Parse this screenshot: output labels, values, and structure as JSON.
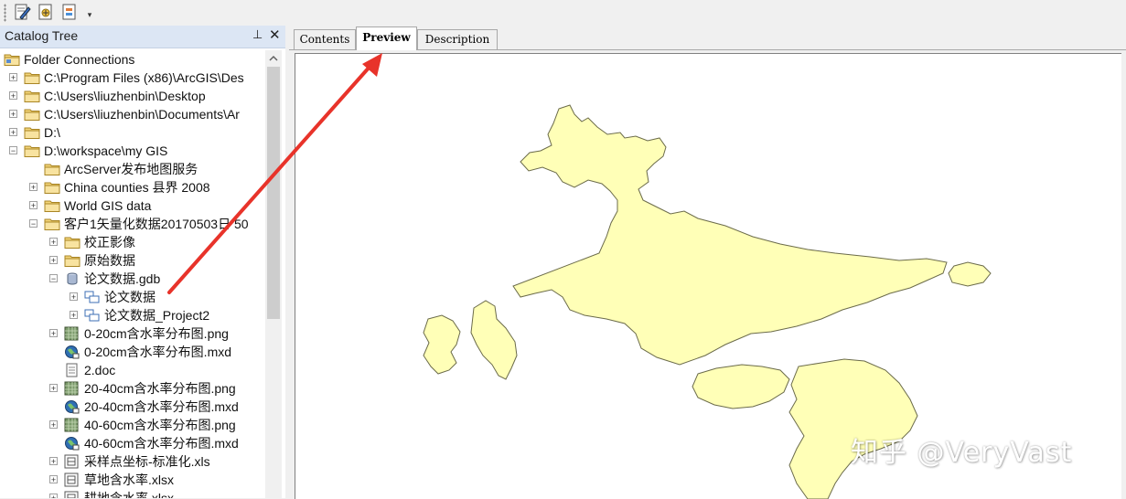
{
  "toolbar": {
    "buttons": [
      "edit-document-icon",
      "add-document-icon",
      "document-properties-icon"
    ],
    "more": "▾"
  },
  "catalog": {
    "title": "Catalog Tree",
    "pin": "⊥",
    "close": "✕",
    "items": [
      {
        "label": "Folder Connections",
        "icon": "folder-connections-icon",
        "expander": ""
      },
      {
        "label": "C:\\Program Files (x86)\\ArcGIS\\Des",
        "icon": "folder-icon",
        "expander": "+"
      },
      {
        "label": "C:\\Users\\liuzhenbin\\Desktop",
        "icon": "folder-icon",
        "expander": "+"
      },
      {
        "label": "C:\\Users\\liuzhenbin\\Documents\\Ar",
        "icon": "folder-icon",
        "expander": "+"
      },
      {
        "label": "D:\\",
        "icon": "folder-icon",
        "expander": "+"
      },
      {
        "label": "D:\\workspace\\my GIS",
        "icon": "folder-icon",
        "expander": "−"
      },
      {
        "label": "ArcServer发布地图服务",
        "icon": "folder-icon",
        "expander": ""
      },
      {
        "label": "China counties 县界 2008",
        "icon": "folder-icon",
        "expander": "+"
      },
      {
        "label": "World GIS data",
        "icon": "folder-icon",
        "expander": "+"
      },
      {
        "label": "客户1矢量化数据20170503日  50",
        "icon": "folder-icon",
        "expander": "−"
      },
      {
        "label": "校正影像",
        "icon": "folder-icon",
        "expander": "+"
      },
      {
        "label": "原始数据",
        "icon": "folder-icon",
        "expander": "+"
      },
      {
        "label": "论文数据.gdb",
        "icon": "geodatabase-icon",
        "expander": "−"
      },
      {
        "label": "论文数据",
        "icon": "feature-dataset-icon",
        "expander": "+"
      },
      {
        "label": "论文数据_Project2",
        "icon": "feature-dataset-icon",
        "expander": "+"
      },
      {
        "label": "0-20cm含水率分布图.png",
        "icon": "raster-icon",
        "expander": "+"
      },
      {
        "label": "0-20cm含水率分布图.mxd",
        "icon": "map-document-icon",
        "expander": ""
      },
      {
        "label": "2.doc",
        "icon": "text-file-icon",
        "expander": ""
      },
      {
        "label": "20-40cm含水率分布图.png",
        "icon": "raster-icon",
        "expander": "+"
      },
      {
        "label": "20-40cm含水率分布图.mxd",
        "icon": "map-document-icon",
        "expander": ""
      },
      {
        "label": "40-60cm含水率分布图.png",
        "icon": "raster-icon",
        "expander": "+"
      },
      {
        "label": "40-60cm含水率分布图.mxd",
        "icon": "map-document-icon",
        "expander": ""
      },
      {
        "label": "采样点坐标-标准化.xls",
        "icon": "table-file-icon",
        "expander": "+"
      },
      {
        "label": "草地含水率.xlsx",
        "icon": "table-file-icon",
        "expander": "+"
      },
      {
        "label": "耕地含水率.xlsx",
        "icon": "table-file-icon",
        "expander": "+"
      }
    ]
  },
  "tabs": [
    {
      "label": "Contents",
      "active": false
    },
    {
      "label": "Preview",
      "active": true
    },
    {
      "label": "Description",
      "active": false
    }
  ],
  "preview": {
    "fill_color": "#ffffb7",
    "stroke_color": "#6b6b4a",
    "annotation_color": "#e8332a"
  },
  "watermark": "知乎 @VeryVast"
}
